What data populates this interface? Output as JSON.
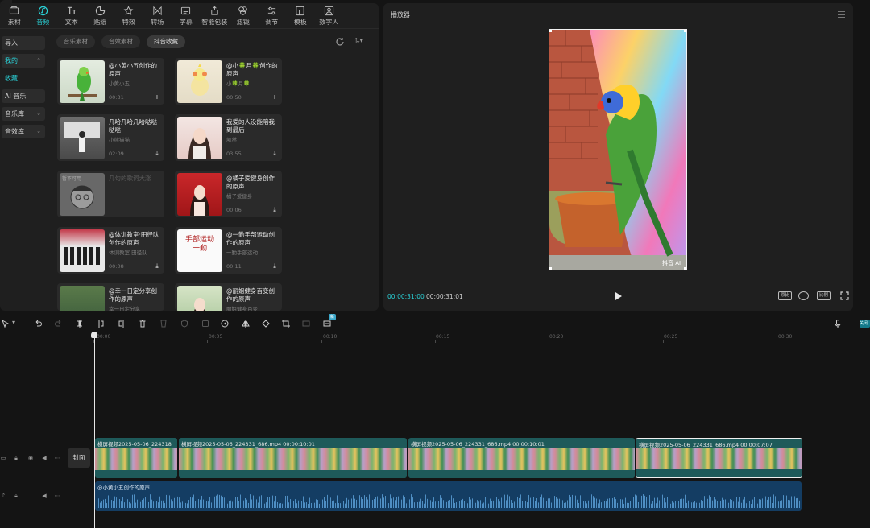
{
  "toolbar": {
    "items": [
      {
        "label": "素材",
        "icon": "media-icon"
      },
      {
        "label": "音频",
        "icon": "audio-icon"
      },
      {
        "label": "文本",
        "icon": "text-icon"
      },
      {
        "label": "贴纸",
        "icon": "sticker-icon"
      },
      {
        "label": "特效",
        "icon": "effects-icon"
      },
      {
        "label": "转场",
        "icon": "transition-icon"
      },
      {
        "label": "字幕",
        "icon": "caption-icon"
      },
      {
        "label": "智能包装",
        "icon": "smart-pack-icon"
      },
      {
        "label": "滤镜",
        "icon": "filter-icon"
      },
      {
        "label": "调节",
        "icon": "adjust-icon"
      },
      {
        "label": "模板",
        "icon": "template-icon"
      },
      {
        "label": "数字人",
        "icon": "avatar-icon"
      }
    ],
    "active_index": 1
  },
  "sidebar": {
    "items": [
      {
        "label": "导入"
      },
      {
        "label": "我的"
      },
      {
        "label": "收藏"
      },
      {
        "label": "AI 音乐"
      },
      {
        "label": "音乐库"
      },
      {
        "label": "音效库"
      }
    ]
  },
  "filters": {
    "tabs": [
      "音乐素材",
      "音效素材",
      "抖音收藏"
    ],
    "selected_index": 2
  },
  "cards": [
    {
      "title": "@小黄小五创作的原声",
      "author": "小黄小五",
      "duration": "00:31",
      "action": "+",
      "thumb": "parrot"
    },
    {
      "title": "@小🍀月🍀创作的原声",
      "author": "小🍀月🍀",
      "duration": "00:50",
      "action": "+",
      "thumb": "bird"
    },
    {
      "title": "几哈几哈几哈哒哒哒哒",
      "author": "小熊猫猫",
      "duration": "02:09",
      "action": "⤓",
      "thumb": "street"
    },
    {
      "title": "我爱的人没能陪我到最后",
      "author": "凯然",
      "duration": "03:55",
      "action": "⤓",
      "thumb": "woman"
    },
    {
      "title": "几句的歌词大涨",
      "author": "",
      "duration": "",
      "action": "",
      "thumb": "cartoon",
      "label": "暂不可用"
    },
    {
      "title": "@橘子爱健身创作的原声",
      "author": "橘子爱健身",
      "duration": "00:06",
      "action": "⤓",
      "thumb": "woman-red"
    },
    {
      "title": "@体训教室·田径队创作的原声",
      "author": "体训教室 田径队",
      "duration": "00:08",
      "action": "⤓",
      "thumb": "team"
    },
    {
      "title": "@一勤手部运动创作的原声",
      "author": "一勤手部运动",
      "duration": "00:11",
      "action": "⤓",
      "thumb": "calligraphy",
      "thumb_text": "手部运动 一勤"
    },
    {
      "title": "@幸一日定分享创作的原声",
      "author": "幸一日定分享",
      "duration": "",
      "action": "",
      "thumb": "forest"
    },
    {
      "title": "@丽姐健身百变创作的原声",
      "author": "丽姐健身百变",
      "duration": "",
      "action": "",
      "thumb": "woman-green"
    }
  ],
  "player": {
    "title": "播放器",
    "timecode_current": "00:00:31:00",
    "timecode_total": "00:00:31:01",
    "watermark": "抖音 AI",
    "controls": [
      "原比",
      "比例"
    ]
  },
  "timeline": {
    "ruler_labels": [
      "00:00",
      "00:05",
      "00:10",
      "00:15",
      "00:20",
      "00:25",
      "00:30"
    ],
    "cover_label": "封面",
    "clips": [
      {
        "label": "横屏视频2025-05-06_224318"
      },
      {
        "label": "横屏视频2025-05-06_224331_686.mp4   00:00:10:01"
      },
      {
        "label": "横屏视频2025-05-06_224331_686.mp4   00:00:10:01"
      },
      {
        "label": "横屏视频2025-05-06_224331_686.mp4   00:00:07:07",
        "selected": true
      }
    ],
    "audio_label": "@小黄小五创作的原声",
    "badge": "关闭"
  }
}
